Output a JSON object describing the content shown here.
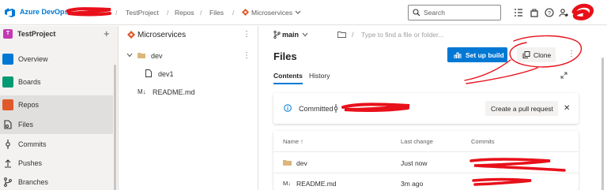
{
  "topbar": {
    "brand": "Azure DevOps",
    "crumbs": [
      "TestProject",
      "Repos",
      "Files",
      "Microservices"
    ],
    "search_placeholder": "Search"
  },
  "leftnav": {
    "project_badge": "T",
    "project_name": "TestProject",
    "add_symbol": "+",
    "items": [
      {
        "label": "Overview",
        "icon": "overview-icon"
      },
      {
        "label": "Boards",
        "icon": "boards-icon"
      },
      {
        "label": "Repos",
        "icon": "repos-icon"
      },
      {
        "label": "Files",
        "icon": "files-icon"
      },
      {
        "label": "Commits",
        "icon": "commits-icon"
      },
      {
        "label": "Pushes",
        "icon": "pushes-icon"
      },
      {
        "label": "Branches",
        "icon": "branches-icon"
      }
    ]
  },
  "tree": {
    "repo_name": "Microservices",
    "more": "⋮",
    "items": [
      {
        "name": "dev",
        "type": "folder"
      },
      {
        "name": "dev1",
        "type": "file"
      },
      {
        "name": "README.md",
        "type": "markdown"
      }
    ]
  },
  "pathbar": {
    "branch": "main",
    "slash": "/",
    "placeholder": "Type to find a file or folder..."
  },
  "main": {
    "title": "Files",
    "tabs": [
      "Contents",
      "History"
    ],
    "setup_build": "Set up build",
    "clone": "Clone",
    "commit_label": "Committed",
    "create_pr": "Create a pull request",
    "close_symbol": "✕",
    "columns": [
      "Name ↑",
      "Last change",
      "Commits"
    ],
    "rows": [
      {
        "name": "dev",
        "last_change": "Just now",
        "type": "folder"
      },
      {
        "name": "README.md",
        "last_change": "3m ago",
        "type": "markdown"
      }
    ]
  },
  "colors": {
    "accent": "#0078d4",
    "project_badge": "#c239b3",
    "annotation_red": "#e8101a"
  }
}
